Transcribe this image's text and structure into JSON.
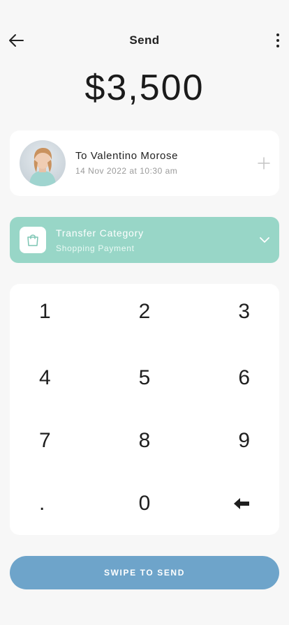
{
  "header": {
    "title": "Send",
    "back_icon": "arrow-left-icon",
    "more_icon": "vertical-dots-icon"
  },
  "amount": "$3,500",
  "recipient": {
    "name": "To Valentino Morose",
    "date": "14 Nov 2022 at 10:30 am",
    "add_icon": "plus-icon"
  },
  "category": {
    "title": "Transfer Category",
    "subtitle": "Shopping Payment",
    "icon": "shopping-bag-icon",
    "chevron_icon": "chevron-down-icon",
    "color": "#98d6c7"
  },
  "keypad": {
    "keys": [
      "1",
      "2",
      "3",
      "4",
      "5",
      "6",
      "7",
      "8",
      "9",
      ".",
      "0"
    ],
    "backspace_icon": "backspace-arrow-icon"
  },
  "swipe": {
    "label": "SWIPE TO SEND",
    "color": "#6ea4ca"
  }
}
